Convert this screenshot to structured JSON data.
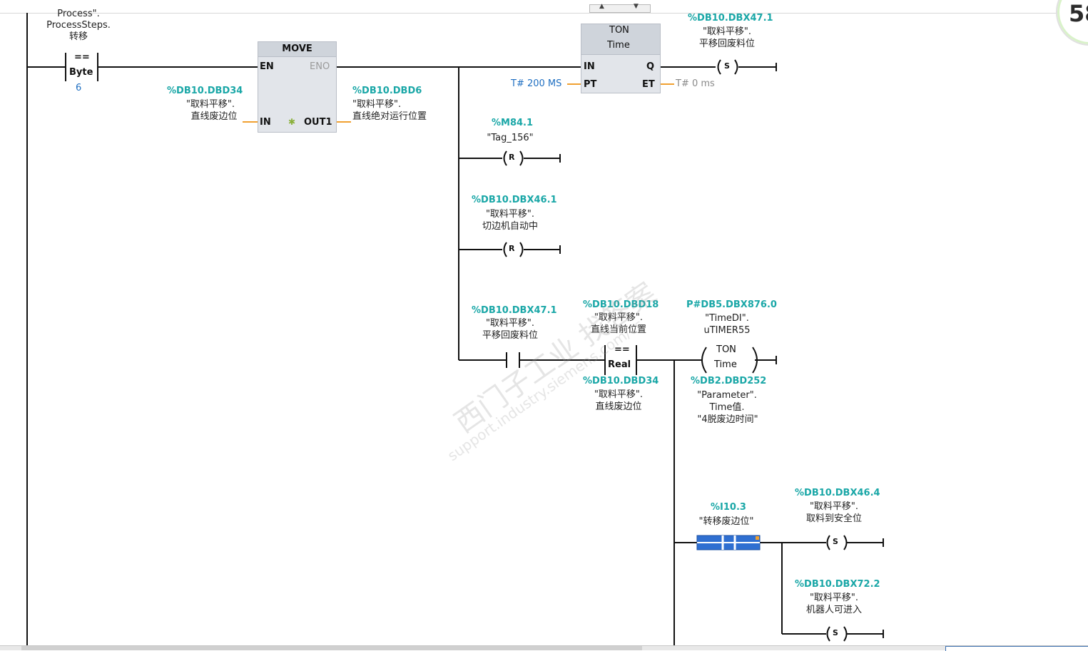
{
  "network_top": {
    "compare_addr_line1": "Process\".",
    "compare_addr_line2": "ProcessSteps.",
    "compare_addr_line3": "转移",
    "compare_op": "==",
    "compare_type": "Byte",
    "compare_value": "6"
  },
  "move": {
    "title": "MOVE",
    "en": "EN",
    "eno": "ENO",
    "in": "IN",
    "out": "OUT1",
    "in_addr": "%DB10.DBD34",
    "in_sym1": "\"取料平移\".",
    "in_sym2": "直线废边位",
    "out_addr": "%DB10.DBD6",
    "out_sym1": "\"取料平移\".",
    "out_sym2": "直线绝对运行位置"
  },
  "ton": {
    "title": "TON",
    "type": "Time",
    "in": "IN",
    "q": "Q",
    "pt": "PT",
    "et": "ET",
    "pt_value": "T# 200 MS",
    "et_value": "T# 0 ms"
  },
  "coil_s1": {
    "addr": "%DB10.DBX47.1",
    "sym1": "\"取料平移\".",
    "sym2": "平移回废料位",
    "letter": "S"
  },
  "coil_r1": {
    "addr": "%M84.1",
    "sym1": "\"Tag_156\"",
    "letter": "R"
  },
  "coil_r2": {
    "addr": "%DB10.DBX46.1",
    "sym1": "\"取料平移\".",
    "sym2": "切边机自动中",
    "letter": "R"
  },
  "contact_no": {
    "addr": "%DB10.DBX47.1",
    "sym1": "\"取料平移\".",
    "sym2": "平移回废料位"
  },
  "compare_real": {
    "addr_top": "%DB10.DBD18",
    "top_sym1": "\"取料平移\".",
    "top_sym2": "直线当前位置",
    "op": "==",
    "type": "Real",
    "addr_bot": "%DB10.DBD34",
    "bot_sym1": "\"取料平移\".",
    "bot_sym2": "直线废边位"
  },
  "ton_coil": {
    "addr": "P#DB5.DBX876.0",
    "sym1": "\"TimeDI\".",
    "sym2": "uTIMER55",
    "title": "TON",
    "type": "Time",
    "param_addr": "%DB2.DBD252",
    "param1": "\"Parameter\".",
    "param2": "Time值.",
    "param3": "\"4脱废边时间\""
  },
  "contact_i": {
    "addr": "%I10.3",
    "sym1": "\"转移废边位\""
  },
  "coil_s2": {
    "addr": "%DB10.DBX46.4",
    "sym1": "\"取料平移\".",
    "sym2": "取料到安全位",
    "letter": "S"
  },
  "coil_s3": {
    "addr": "%DB10.DBX72.2",
    "sym1": "\"取料平移\".",
    "sym2": "机器人可进入",
    "letter": "S"
  },
  "badge": {
    "text": "58"
  },
  "watermark": {
    "line1": "西门子工业 找答案",
    "line2": "support.industry.siemens.com/cs"
  }
}
